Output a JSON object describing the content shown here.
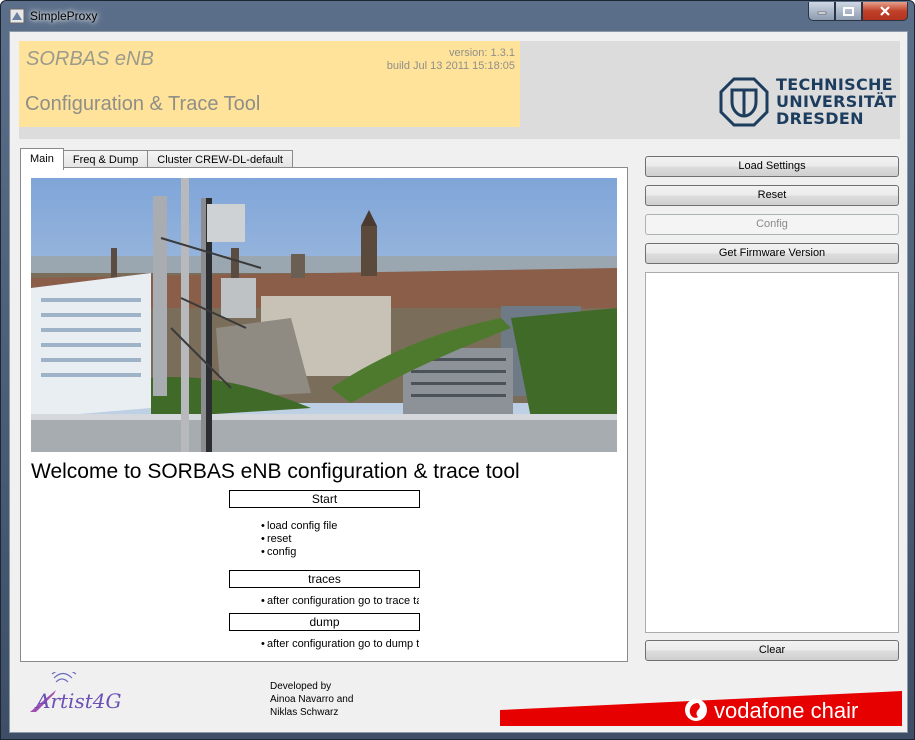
{
  "window": {
    "title": "SimpleProxy"
  },
  "header": {
    "product": "SORBAS eNB",
    "tool_title": "Configuration & Trace Tool",
    "version": "version: 1.3.1",
    "build": "build Jul 13 2011 15:18:05",
    "tud_line1": "TECHNISCHE",
    "tud_line2": "UNIVERSITÄT",
    "tud_line3": "DRESDEN"
  },
  "tabs": [
    {
      "label": "Main"
    },
    {
      "label": "Freq & Dump"
    },
    {
      "label": "Cluster CREW-DL-default"
    }
  ],
  "main": {
    "welcome": "Welcome to SORBAS eNB configuration & trace tool",
    "start_label": "Start",
    "start_items": [
      "load config file",
      "reset",
      "config"
    ],
    "traces_label": "traces",
    "traces_items": [
      "after configuration go to trace tab"
    ],
    "dump_label": "dump",
    "dump_items": [
      "after configuration go to dump tab"
    ]
  },
  "buttons": {
    "load_settings": "Load Settings",
    "reset": "Reset",
    "config": "Config",
    "firmware": "Get Firmware Version",
    "clear": "Clear"
  },
  "footer": {
    "artist_logo": "Artist4G",
    "dev_line1": "Developed by",
    "dev_line2": "Ainoa Navarro and",
    "dev_line3": "Niklas Schwarz",
    "vodafone": "vodafone chair"
  },
  "colors": {
    "header_yellow": "#ffe39b",
    "header_gray": "#dcdcdc",
    "tud_blue": "#1c3d5e",
    "vodafone_red": "#e60000"
  }
}
